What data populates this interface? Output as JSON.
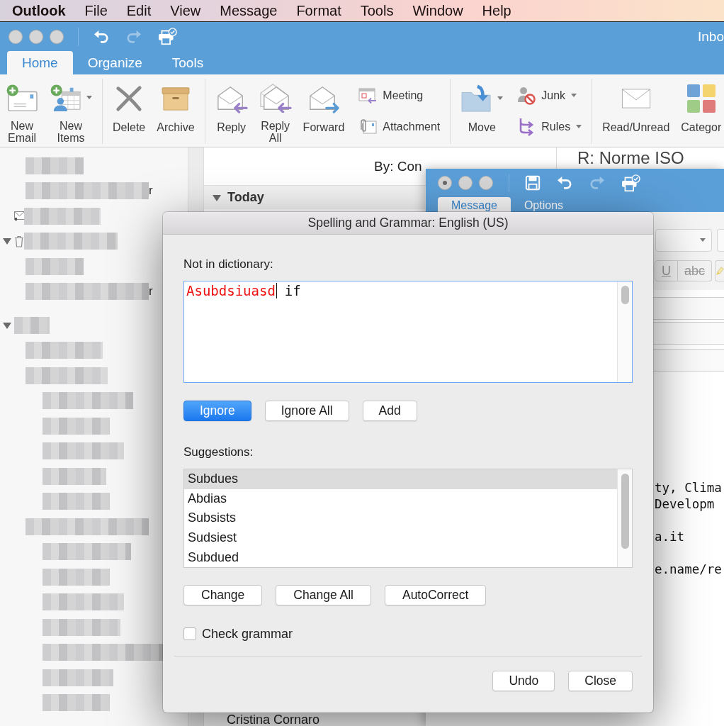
{
  "menu_bar": {
    "app_name": "Outlook",
    "items": [
      "File",
      "Edit",
      "View",
      "Message",
      "Format",
      "Tools",
      "Window",
      "Help"
    ]
  },
  "main_window": {
    "title": "Inbo",
    "toolbar": [
      {
        "disabled": false
      },
      {
        "disabled": true
      },
      {
        "disabled": false
      }
    ],
    "tabs": [
      {
        "label": "Home",
        "selected": true
      },
      {
        "label": "Organize",
        "selected": false
      },
      {
        "label": "Tools",
        "selected": false
      }
    ],
    "ribbon": [
      {
        "items": [
          {
            "kind": "large",
            "label": "New\nEmail",
            "menu": false
          },
          {
            "kind": "large",
            "label": "New\nItems",
            "menu": true
          }
        ]
      },
      {
        "items": [
          {
            "kind": "large",
            "label": "Delete",
            "menu": false
          },
          {
            "kind": "large",
            "label": "Archive",
            "menu": false
          }
        ]
      },
      {
        "items": [
          {
            "kind": "large",
            "label": "Reply",
            "menu": false
          },
          {
            "kind": "large",
            "label": "Reply\nAll",
            "menu": false
          },
          {
            "kind": "large",
            "label": "Forward",
            "menu": false
          },
          {
            "kind": "small",
            "label": "Meeting",
            "menu": false
          },
          {
            "kind": "small",
            "label": "Attachment",
            "menu": false
          }
        ]
      },
      {
        "items": [
          {
            "kind": "large",
            "label": "Move",
            "menu": true
          },
          {
            "kind": "small",
            "label": "Junk",
            "menu": true
          },
          {
            "kind": "small",
            "label": "Rules",
            "menu": true
          }
        ]
      },
      {
        "items": [
          {
            "kind": "large",
            "label": "Read/Unread",
            "menu": false
          },
          {
            "kind": "large",
            "label": "Categor",
            "menu": false
          }
        ]
      }
    ],
    "folders": [
      {
        "kind": "folder"
      },
      {
        "kind": "folder",
        "visible_text": "r"
      },
      {
        "kind": "outbox"
      },
      {
        "kind": "trash",
        "expanded": true,
        "children": [
          {
            "kind": "folder"
          },
          {
            "kind": "folder",
            "visible_text": "r"
          }
        ]
      },
      {
        "kind": "account",
        "expanded": true,
        "children": [
          {
            "kind": "folder"
          },
          {
            "kind": "folder",
            "children": [
              {
                "kind": "folder"
              },
              {
                "kind": "folder"
              },
              {
                "kind": "folder"
              },
              {
                "kind": "folder"
              },
              {
                "kind": "folder"
              }
            ]
          },
          {
            "kind": "folder",
            "children": [
              {
                "kind": "folder"
              },
              {
                "kind": "folder"
              },
              {
                "kind": "folder"
              },
              {
                "kind": "folder"
              },
              {
                "kind": "folder"
              },
              {
                "kind": "folder"
              },
              {
                "kind": "folder"
              }
            ]
          }
        ]
      }
    ],
    "message_list": {
      "sort_label": "By: Con",
      "groups": [
        {
          "label": "Today",
          "expanded": true
        }
      ],
      "sender": "Cristina Cornaro"
    },
    "reading_pane": {
      "subject": "R: Norme ISO"
    }
  },
  "compose_window": {
    "edited": true,
    "toolbar": [
      {
        "disabled": false
      },
      {
        "disabled": false
      },
      {
        "disabled": true
      },
      {
        "disabled": false
      }
    ],
    "tabs": [
      {
        "label": "Message",
        "selected": true
      },
      {
        "label": "Options",
        "selected": false
      }
    ],
    "format_buttons": [
      "U",
      "abc"
    ],
    "body_paragraphs": [
      [
        "ty, Clima",
        "Developm"
      ],
      [
        "a.it"
      ],
      [
        "e.name/re"
      ]
    ]
  },
  "dialog": {
    "title": "Spelling and Grammar: English (US)",
    "not_in_dictionary_label": "Not in dictionary:",
    "sentence": [
      {
        "text": "Asubdsiuasd",
        "flagged": true,
        "cursor": true
      },
      {
        "text": "if",
        "flagged": false,
        "cursor": false
      }
    ],
    "word_buttons": [
      {
        "label": "Ignore",
        "default": true
      },
      {
        "label": "Ignore All",
        "default": false
      },
      {
        "label": "Add",
        "default": false
      }
    ],
    "suggestions_label": "Suggestions:",
    "suggestions": [
      {
        "label": "Subdues",
        "selected": true
      },
      {
        "label": "Abdias",
        "selected": false
      },
      {
        "label": "Subsists",
        "selected": false
      },
      {
        "label": "Sudsiest",
        "selected": false
      },
      {
        "label": "Subdued",
        "selected": false
      }
    ],
    "suggestion_buttons": [
      {
        "label": "Change",
        "default": false
      },
      {
        "label": "Change All",
        "default": false
      },
      {
        "label": "AutoCorrect",
        "default": false
      }
    ],
    "check_grammar": {
      "label": "Check grammar",
      "checked": false
    },
    "footer_buttons": [
      {
        "label": "Undo",
        "default": false
      },
      {
        "label": "Close",
        "default": false
      }
    ]
  }
}
